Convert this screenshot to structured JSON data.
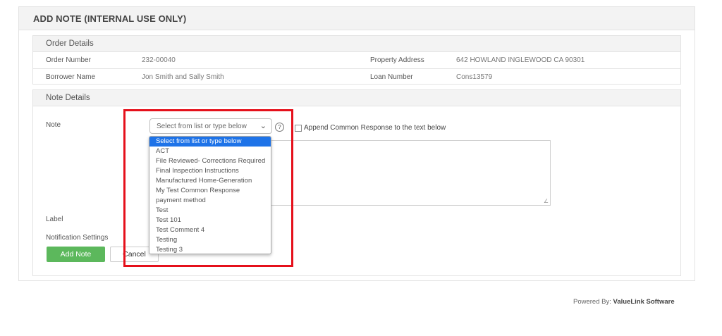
{
  "panel": {
    "title": "ADD NOTE (INTERNAL USE ONLY)"
  },
  "order_details": {
    "title": "Order Details",
    "order_number_label": "Order Number",
    "order_number": "232-00040",
    "property_address_label": "Property Address",
    "property_address": "642 HOWLAND INGLEWOOD CA 90301",
    "borrower_name_label": "Borrower Name",
    "borrower_name": "Jon Smith and Sally Smith",
    "loan_number_label": "Loan Number",
    "loan_number": "Cons13579"
  },
  "note_details": {
    "title": "Note Details",
    "note_label": "Note",
    "select_value": "Select from list or type below",
    "help_glyph": "?",
    "append_label": "Append Common Response to the text below",
    "label_label": "Label",
    "notification_label": "Notification Settings",
    "add_button": "Add Note",
    "cancel_button": "Cancel"
  },
  "dropdown": {
    "options": [
      "Select from list or type below",
      "ACT",
      "File Reviewed- Corrections Required",
      "Final Inspection Instructions",
      "Manufactured Home-Generation",
      "My Test Common Response",
      "payment method",
      "Test",
      "Test 101",
      "Test Comment 4",
      "Testing",
      "Testing 3"
    ],
    "selected_index": 0
  },
  "footer": {
    "prefix": "Powered By:",
    "brand": "ValueLink Software"
  },
  "colors": {
    "highlight": "#e5101b",
    "add_button": "#5cb85c",
    "selected_option": "#1e73e8"
  }
}
